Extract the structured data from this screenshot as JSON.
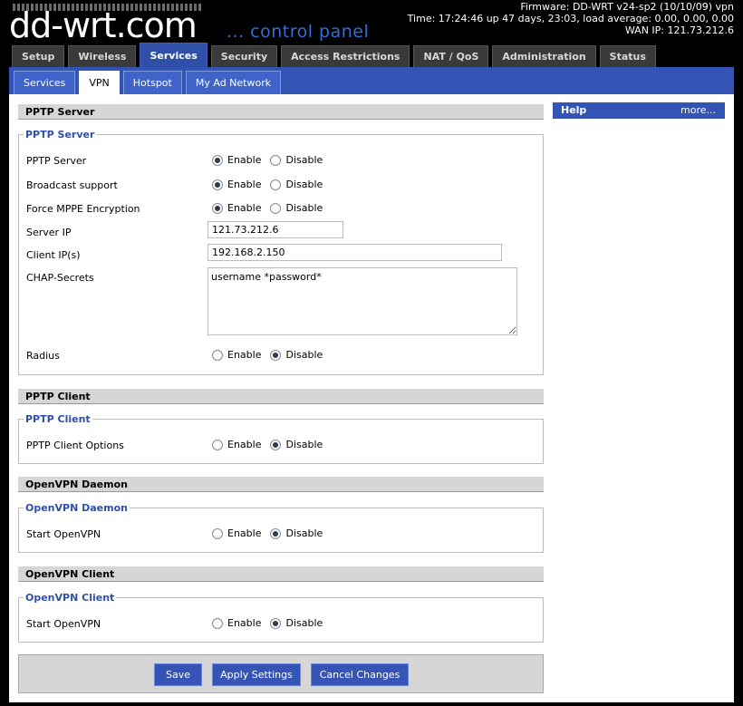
{
  "header": {
    "logo_main": "dd-wrt",
    "logo_suffix": ".com",
    "tagline": "... control panel",
    "firmware": "Firmware: DD-WRT v24-sp2 (10/10/09) vpn",
    "time": "Time: 17:24:46 up 47 days, 23:03, load average: 0.00, 0.00, 0.00",
    "wan_ip": "WAN IP: 121.73.212.6"
  },
  "main_tabs": [
    {
      "label": "Setup"
    },
    {
      "label": "Wireless"
    },
    {
      "label": "Services"
    },
    {
      "label": "Security"
    },
    {
      "label": "Access Restrictions"
    },
    {
      "label": "NAT / QoS"
    },
    {
      "label": "Administration"
    },
    {
      "label": "Status"
    }
  ],
  "sub_tabs": [
    {
      "label": "Services"
    },
    {
      "label": "VPN"
    },
    {
      "label": "Hotspot"
    },
    {
      "label": "My Ad Network"
    }
  ],
  "radio_labels": {
    "enable": "Enable",
    "disable": "Disable"
  },
  "pptp_server": {
    "header": "PPTP Server",
    "legend": "PPTP Server",
    "server_label": "PPTP Server",
    "broadcast_label": "Broadcast support",
    "mppe_label": "Force MPPE Encryption",
    "server_ip_label": "Server IP",
    "server_ip_value": "121.73.212.6",
    "client_ip_label": "Client IP(s)",
    "client_ip_value": "192.168.2.150",
    "chap_label": "CHAP-Secrets",
    "chap_value": "username *password*",
    "radius_label": "Radius"
  },
  "pptp_client": {
    "header": "PPTP Client",
    "legend": "PPTP Client",
    "options_label": "PPTP Client Options"
  },
  "openvpn_daemon": {
    "header": "OpenVPN Daemon",
    "legend": "OpenVPN Daemon",
    "start_label": "Start OpenVPN"
  },
  "openvpn_client": {
    "header": "OpenVPN Client",
    "legend": "OpenVPN Client",
    "start_label": "Start OpenVPN"
  },
  "help": {
    "title": "Help",
    "more": "more..."
  },
  "buttons": {
    "save": "Save",
    "apply": "Apply Settings",
    "cancel": "Cancel Changes"
  }
}
